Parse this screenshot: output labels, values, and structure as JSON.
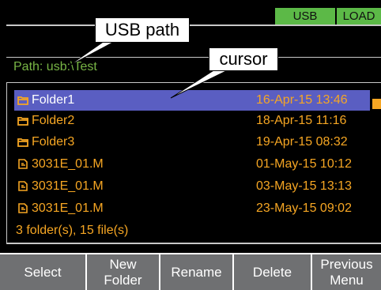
{
  "status": {
    "usb": "USB",
    "load": "LOAD"
  },
  "path": {
    "label": "Path: usb:\\Test"
  },
  "callouts": {
    "usb_path": "USB path",
    "cursor": "cursor"
  },
  "files": [
    {
      "name": "Folder1",
      "date": "16-Apr-15 13:46",
      "type": "folder",
      "selected": true
    },
    {
      "name": "Folder2",
      "date": "18-Apr-15 11:16",
      "type": "folder",
      "selected": false
    },
    {
      "name": "Folder3",
      "date": "19-Apr-15 08:32",
      "type": "folder",
      "selected": false
    },
    {
      "name": "3031E_01.M",
      "date": "01-May-15 10:12",
      "type": "file",
      "selected": false
    },
    {
      "name": "3031E_01.M",
      "date": "03-May-15 13:13",
      "type": "file",
      "selected": false
    },
    {
      "name": "3031E_01.M",
      "date": "23-May-15 09:02",
      "type": "file",
      "selected": false
    }
  ],
  "summary": "3 folder(s), 15 file(s)",
  "softkeys": [
    {
      "label": "Select"
    },
    {
      "label": "New\nFolder"
    },
    {
      "label": "Rename"
    },
    {
      "label": "Delete"
    },
    {
      "label": "Previous\nMenu"
    }
  ],
  "colors": {
    "accent_green": "#5cb947",
    "text_orange": "#f6a623",
    "selection_blue": "#5a5ec2",
    "softkey_gray": "#6f7072"
  }
}
